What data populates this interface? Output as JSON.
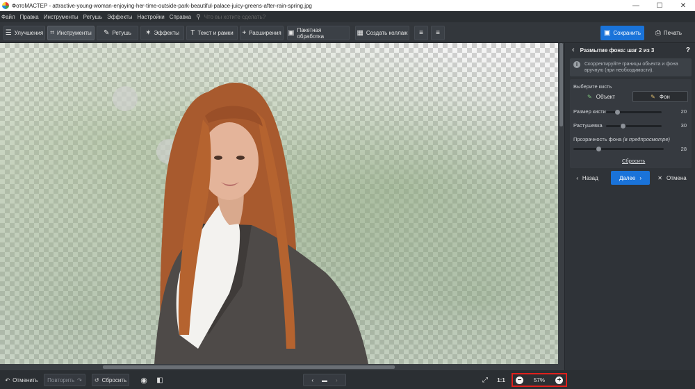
{
  "window": {
    "title": "ФотоМАСТЕР - attractive-young-woman-enjoying-her-time-outside-park-beautiful-palace-juicy-greens-after-rain-spring.jpg",
    "minimize": "—",
    "maximize": "☐",
    "close": "✕"
  },
  "menu": {
    "items": [
      "Файл",
      "Правка",
      "Инструменты",
      "Ретушь",
      "Эффекты",
      "Настройки",
      "Справка"
    ],
    "search_placeholder": "Что вы хотите сделать?"
  },
  "toolbar": {
    "tabs": [
      {
        "label": "Улучшения",
        "icon": "sliders-icon",
        "glyph": "☰",
        "active": false
      },
      {
        "label": "Инструменты",
        "icon": "crop-icon",
        "glyph": "⌗",
        "active": true
      },
      {
        "label": "Ретушь",
        "icon": "brush-icon",
        "glyph": "✎",
        "active": false
      },
      {
        "label": "Эффекты",
        "icon": "sparkle-icon",
        "glyph": "✶",
        "active": false
      },
      {
        "label": "Текст и рамки",
        "icon": "text-icon",
        "glyph": "T",
        "active": false
      },
      {
        "label": "Расширения",
        "icon": "plus-icon",
        "glyph": "+",
        "active": false
      },
      {
        "label": "Пакетная обработка",
        "icon": "batch-icon",
        "glyph": "▣",
        "active": false
      },
      {
        "label": "Создать коллаж",
        "icon": "collage-icon",
        "glyph": "▦",
        "active": false
      }
    ],
    "save_label": "Сохранить",
    "print_label": "Печать"
  },
  "panel": {
    "title": "Размытие фона: шаг 2 из 3",
    "help": "?",
    "info_text": "Скорректируйте границы объекта и фона вручную (при необходимости).",
    "brush_title": "Выберите кисть",
    "brush_object": "Объект",
    "brush_bg": "Фон",
    "sliders": [
      {
        "label": "Размер кисти",
        "value": 20,
        "fraction": 0.2
      },
      {
        "label": "Растушевка",
        "value": 30,
        "fraction": 0.3
      },
      {
        "label": "Прозрачность фона",
        "label_note": "(в предпросмотре)",
        "value": 28,
        "fraction": 0.28
      }
    ],
    "reset_link": "Сбросить",
    "back_label": "Назад",
    "next_label": "Далее",
    "cancel_label": "Отмена",
    "accent_color": "#1a73d9"
  },
  "bottom": {
    "undo_label": "Отменить",
    "redo_label": "Повторить",
    "reset_label": "Сбросить",
    "ratio_label": "1:1",
    "zoom_value": "57%"
  }
}
